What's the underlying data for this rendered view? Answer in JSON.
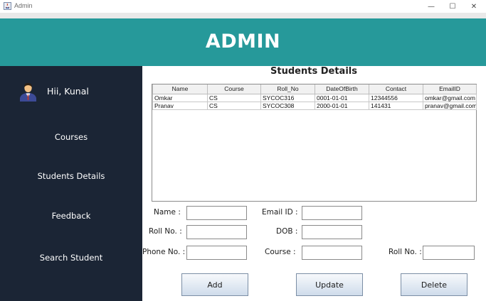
{
  "window": {
    "title": "Admin",
    "minimize_glyph": "—",
    "maximize_glyph": "☐",
    "close_glyph": "✕"
  },
  "header": {
    "title": "ADMIN"
  },
  "sidebar": {
    "greeting": "Hii, Kunal",
    "items": [
      {
        "label": "Courses"
      },
      {
        "label": "Students Details"
      },
      {
        "label": "Feedback"
      },
      {
        "label": "Search Student"
      }
    ]
  },
  "main": {
    "title": "Students Details",
    "table": {
      "columns": [
        "Name",
        "Course",
        "Roll_No",
        "DateOfBirth",
        "Contact",
        "EmailID"
      ],
      "rows": [
        [
          "Omkar",
          "CS",
          "SYCOC316",
          "0001-01-01",
          "12344556",
          "omkar@gmail.com"
        ],
        [
          "Pranav",
          "CS",
          "SYCOC308",
          "2000-01-01",
          "141431",
          "pranav@gmail.com"
        ]
      ]
    },
    "form": {
      "name_label": "Name  :",
      "email_label": "Email ID  :",
      "rollno_label": "Roll No.  :",
      "dob_label": "DOB  :",
      "phone_label": "Phone No. :",
      "course_label": "Course  :",
      "rollno2_label": "Roll No.  :",
      "name_value": "",
      "email_value": "",
      "rollno_value": "",
      "dob_value": "",
      "phone_value": "",
      "course_value": "",
      "rollno2_value": ""
    },
    "buttons": {
      "add": "Add",
      "update": "Update",
      "delete": "Delete"
    }
  },
  "colors": {
    "header_bg": "#26999a",
    "sidebar_bg": "#1b2535"
  }
}
